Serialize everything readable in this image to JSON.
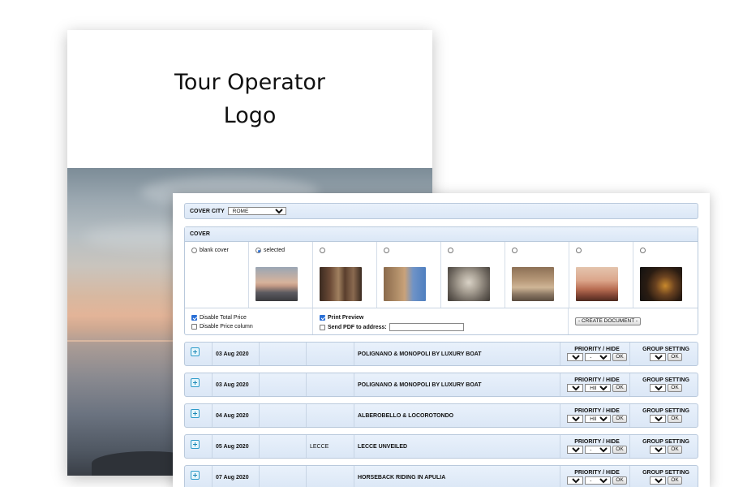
{
  "document_mock": {
    "logo_text_line1": "Tour Operator",
    "logo_text_line2": "Logo"
  },
  "cover_city": {
    "label": "COVER CITY",
    "selected": "ROME"
  },
  "cover": {
    "label": "COVER",
    "options": [
      {
        "label": "blank cover",
        "selected": false,
        "image": null
      },
      {
        "label": "selected",
        "selected": true,
        "image": "coastal-sunset-photo"
      },
      {
        "label": "",
        "selected": false,
        "image": "pantheon-photo"
      },
      {
        "label": "",
        "selected": false,
        "image": "colosseum-photo"
      },
      {
        "label": "",
        "selected": false,
        "image": "statue-photo"
      },
      {
        "label": "",
        "selected": false,
        "image": "trevi-fountain-photo"
      },
      {
        "label": "",
        "selected": false,
        "image": "rome-skyline-photo"
      },
      {
        "label": "",
        "selected": false,
        "image": "night-colosseum-photo"
      }
    ],
    "disable_total_price": {
      "label": "Disable Total Price",
      "checked": true
    },
    "disable_price_column": {
      "label": "Disable Price column",
      "checked": false
    },
    "print_preview": {
      "label": "Print Preview",
      "checked": true
    },
    "send_pdf": {
      "label": "Send PDF to address:",
      "checked": false,
      "value": ""
    },
    "create_button": "- CREATE DOCUMENT -"
  },
  "columns": {
    "priority_label": "PRIORITY / HIDE",
    "group_label": "GROUP SETTING",
    "ok_label": "OK"
  },
  "activities": [
    {
      "date": "03 Aug 2020",
      "city": "",
      "title": "POLIGNANO & MONOPOLI BY LUXURY BOAT",
      "priority": "0",
      "hide": "-",
      "group": "A"
    },
    {
      "date": "03 Aug 2020",
      "city": "",
      "title": "POLIGNANO & MONOPOLI BY LUXURY BOAT",
      "priority": "0",
      "hide": "HIDE",
      "group": "A"
    },
    {
      "date": "04 Aug 2020",
      "city": "",
      "title": "ALBEROBELLO & LOCOROTONDO",
      "priority": "0",
      "hide": "HIDE",
      "group": "-"
    },
    {
      "date": "05 Aug 2020",
      "city": "LECCE",
      "title": "LECCE UNVEILED",
      "priority": "4",
      "hide": "-",
      "group": "B"
    },
    {
      "date": "07 Aug 2020",
      "city": "",
      "title": "HORSEBACK RIDING IN APULIA",
      "priority": "0",
      "hide": "-",
      "group": "-"
    }
  ]
}
